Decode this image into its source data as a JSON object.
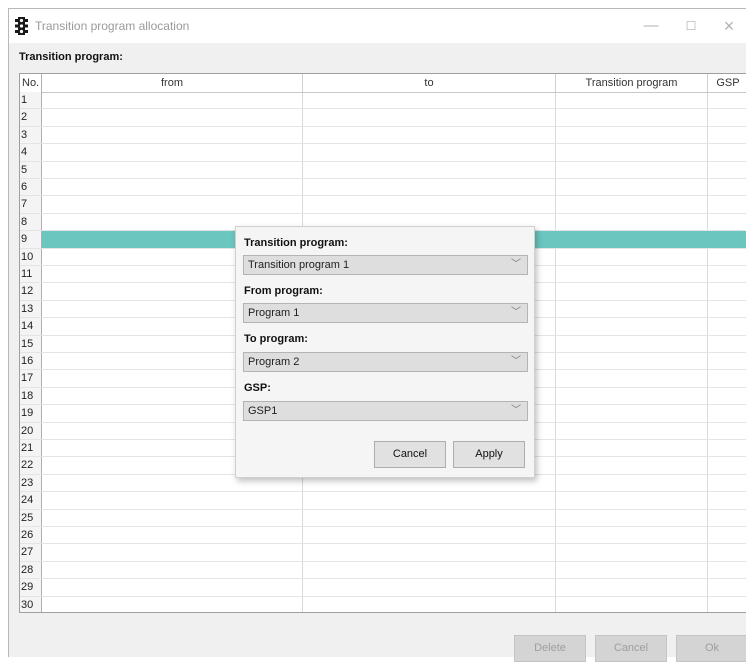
{
  "window": {
    "title": "Transition program allocation",
    "controls": {
      "minimize": "—",
      "maximize": "☐",
      "close": "×"
    }
  },
  "section_label": "Transition program:",
  "table": {
    "columns": [
      "No.",
      "from",
      "to",
      "Transition program",
      "GSP"
    ],
    "rows": [
      "1",
      "2",
      "3",
      "4",
      "5",
      "6",
      "7",
      "8",
      "9",
      "10",
      "11",
      "12",
      "13",
      "14",
      "15",
      "16",
      "17",
      "18",
      "19",
      "20",
      "21",
      "22",
      "23",
      "24",
      "25",
      "26",
      "27",
      "28",
      "29",
      "30"
    ],
    "selected_row": "9",
    "selected_color": "#6cc6c0"
  },
  "popup": {
    "transition_label": "Transition program:",
    "transition_value": "Transition program 1",
    "from_label": "From program:",
    "from_value": "Program 1",
    "to_label": "To program:",
    "to_value": "Program 2",
    "gsp_label": "GSP:",
    "gsp_value": "GSP1",
    "cancel": "Cancel",
    "apply": "Apply"
  },
  "footer": {
    "delete": "Delete",
    "cancel": "Cancel",
    "ok": "Ok"
  }
}
